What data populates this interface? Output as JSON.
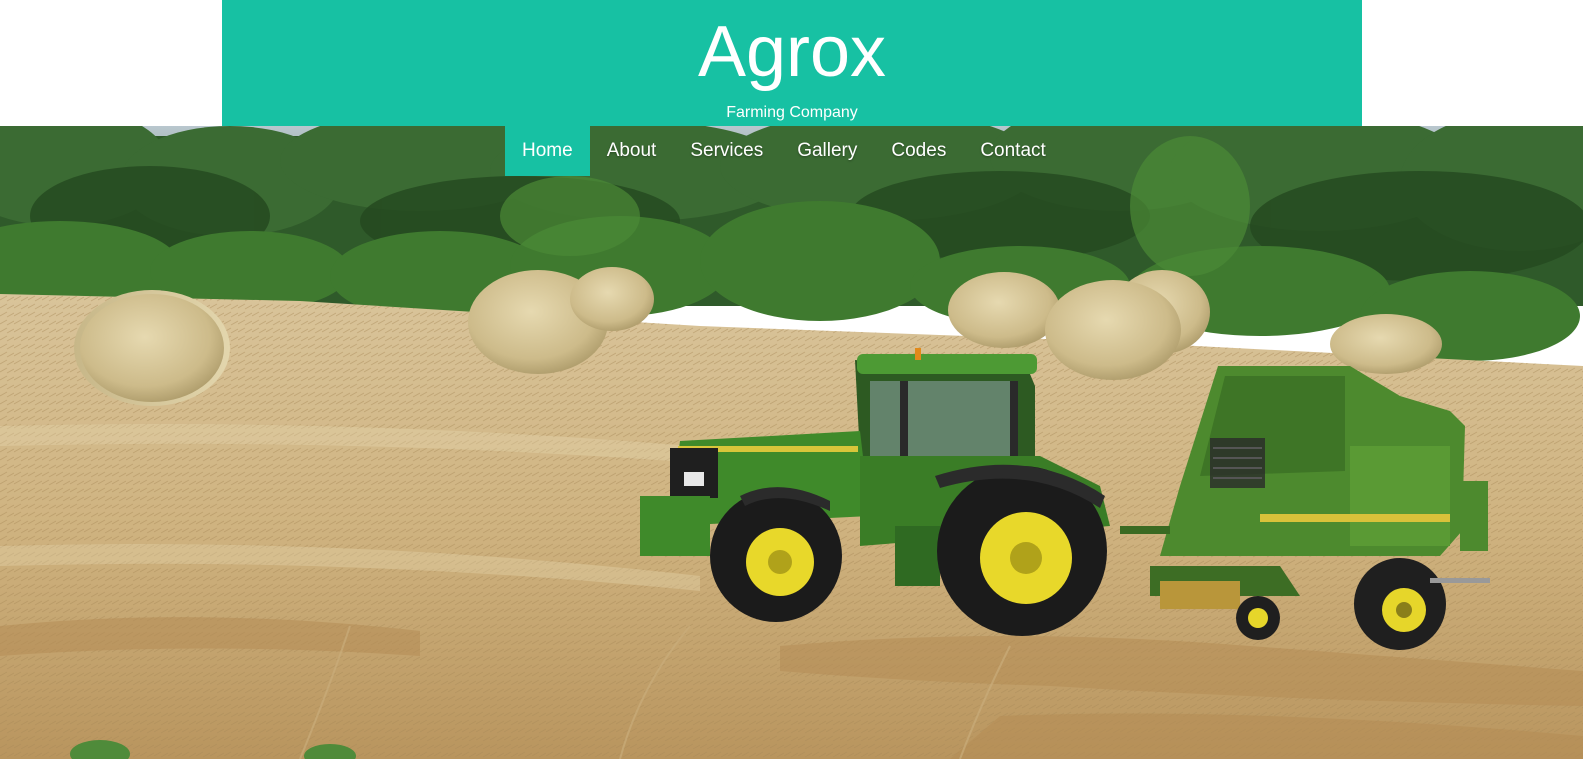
{
  "brand": {
    "title": "Agrox",
    "subtitle": "Farming Company"
  },
  "nav": {
    "items": [
      {
        "label": "Home",
        "active": true
      },
      {
        "label": "About",
        "active": false
      },
      {
        "label": "Services",
        "active": false
      },
      {
        "label": "Gallery",
        "active": false
      },
      {
        "label": "Codes",
        "active": false
      },
      {
        "label": "Contact",
        "active": false
      }
    ]
  },
  "colors": {
    "accent": "#17c1a3",
    "nav_text": "#ffffff"
  }
}
